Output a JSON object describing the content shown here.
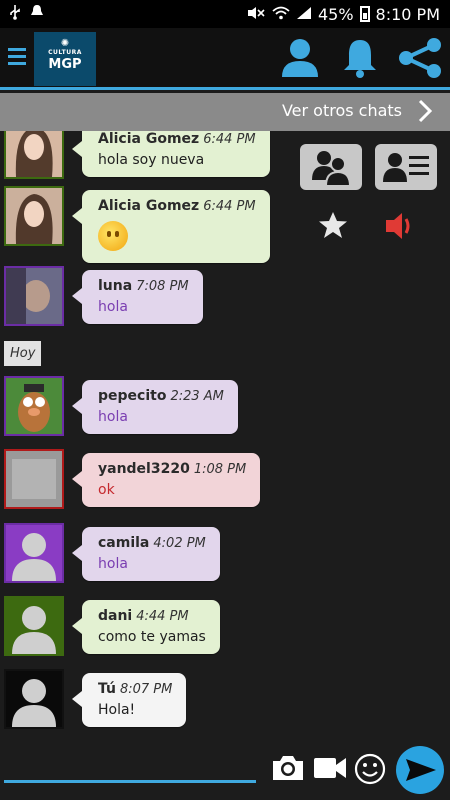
{
  "status_bar": {
    "battery": "45%",
    "time": "8:10 PM"
  },
  "logo": {
    "line1": "CULTURA",
    "line2": "MGP"
  },
  "chats_bar": {
    "label": "Ver otros chats"
  },
  "day_separator": "Hoy",
  "messages": [
    {
      "sender": "Alicia Gomez",
      "time": "6:44 PM",
      "text": "hola soy nueva",
      "bubble": "green",
      "text_color": "dark"
    },
    {
      "sender": "Alicia Gomez",
      "time": "6:44 PM",
      "text": "",
      "emoji": "smiley-emoji",
      "bubble": "green"
    },
    {
      "sender": "luna",
      "time": "7:08 PM",
      "text": "hola",
      "bubble": "purple",
      "text_color": "purple"
    },
    {
      "sender": "pepecito",
      "time": "2:23 AM",
      "text": "hola",
      "bubble": "purple",
      "text_color": "purple"
    },
    {
      "sender": "yandel3220",
      "time": "1:08 PM",
      "text": "ok",
      "bubble": "red",
      "text_color": "red"
    },
    {
      "sender": "camila",
      "time": "4:02 PM",
      "text": "hola",
      "bubble": "purple",
      "text_color": "purple"
    },
    {
      "sender": "dani",
      "time": "4:44 PM",
      "text": "como te yamas",
      "bubble": "green",
      "text_color": "dark"
    },
    {
      "sender": "Tú",
      "time": "8:07 PM",
      "text": "Hola!",
      "bubble": "white",
      "text_color": "dark"
    }
  ],
  "input": {
    "value": "",
    "placeholder": ""
  },
  "colors": {
    "accent": "#3fa9df",
    "mute_red": "#e03a35",
    "green_bubble": "#e3f1d2",
    "purple_bubble": "#e2d6ec",
    "red_bubble": "#f2d4d8"
  }
}
